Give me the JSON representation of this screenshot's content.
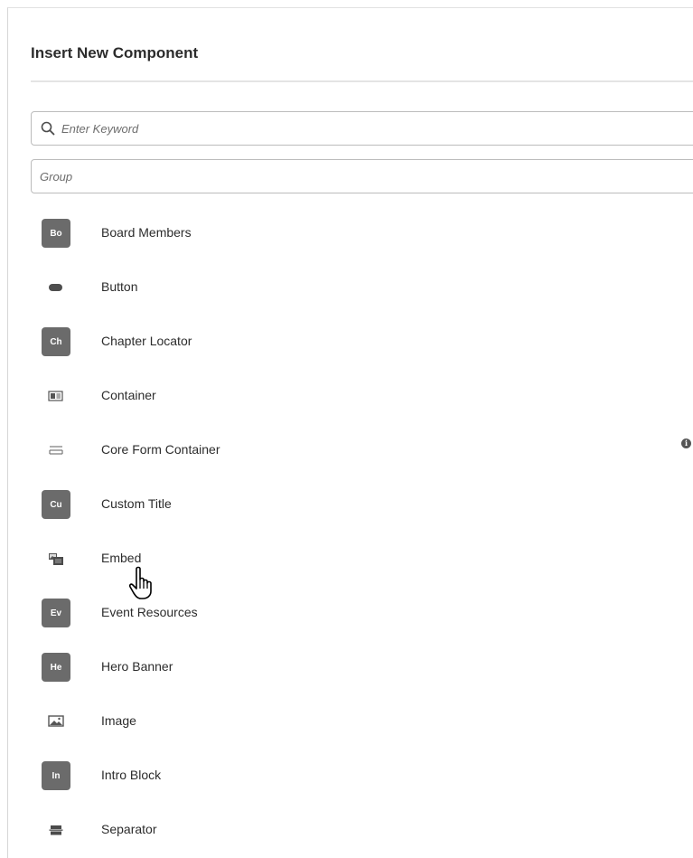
{
  "dialog": {
    "title": "Insert New Component",
    "search": {
      "placeholder": "Enter Keyword",
      "icon": "search-icon"
    },
    "group": {
      "placeholder": "Group"
    },
    "items": [
      {
        "label": "Board Members",
        "badge": "Bo",
        "icon": null
      },
      {
        "label": "Button",
        "badge": null,
        "icon": "button-icon"
      },
      {
        "label": "Chapter Locator",
        "badge": "Ch",
        "icon": null
      },
      {
        "label": "Container",
        "badge": null,
        "icon": "container-icon"
      },
      {
        "label": "Core Form Container",
        "badge": null,
        "icon": "form-container-icon",
        "info": "i"
      },
      {
        "label": "Custom Title",
        "badge": "Cu",
        "icon": null
      },
      {
        "label": "Embed",
        "badge": null,
        "icon": "embed-icon"
      },
      {
        "label": "Event Resources",
        "badge": "Ev",
        "icon": null
      },
      {
        "label": "Hero Banner",
        "badge": "He",
        "icon": null
      },
      {
        "label": "Image",
        "badge": null,
        "icon": "image-icon"
      },
      {
        "label": "Intro Block",
        "badge": "In",
        "icon": null
      },
      {
        "label": "Separator",
        "badge": null,
        "icon": "separator-icon"
      }
    ]
  },
  "colors": {
    "badge_bg": "#6b6b6b",
    "text": "#2c2c2c",
    "border": "#bcbcbc"
  }
}
